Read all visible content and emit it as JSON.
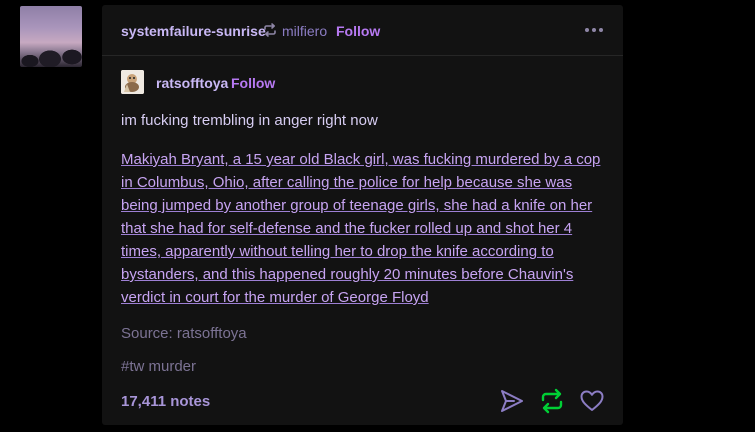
{
  "reblogger": {
    "name": "systemfailure-sunrise",
    "source_blog": "milfiero",
    "follow_label": "Follow"
  },
  "trail": {
    "name": "ratsofftoya",
    "follow_label": "Follow",
    "intro": "im fucking trembling in anger right now",
    "link_text": "Makiyah Bryant, a 15 year old Black girl, was fucking murdered by a cop in Columbus, Ohio, after calling the police for help because she was being jumped by another group of teenage girls, she had a knife on her that she had for self-defense and the fucker rolled up and shot her 4 times, apparently without telling her to drop the knife according to bystanders, and this happened roughly 20 minutes before Chauvin's verdict in court for the murder of George Floyd"
  },
  "source": {
    "label": "Source:",
    "blog": "ratsofftoya"
  },
  "tags": [
    "#tw murder"
  ],
  "notes": "17,411 notes",
  "colors": {
    "accent": "#b779f2",
    "reblog_green": "#00cf35",
    "action_icon": "#8c7dc4"
  },
  "icons": [
    "reblog-icon",
    "more-icon",
    "share-icon",
    "reblog-action-icon",
    "heart-icon"
  ]
}
